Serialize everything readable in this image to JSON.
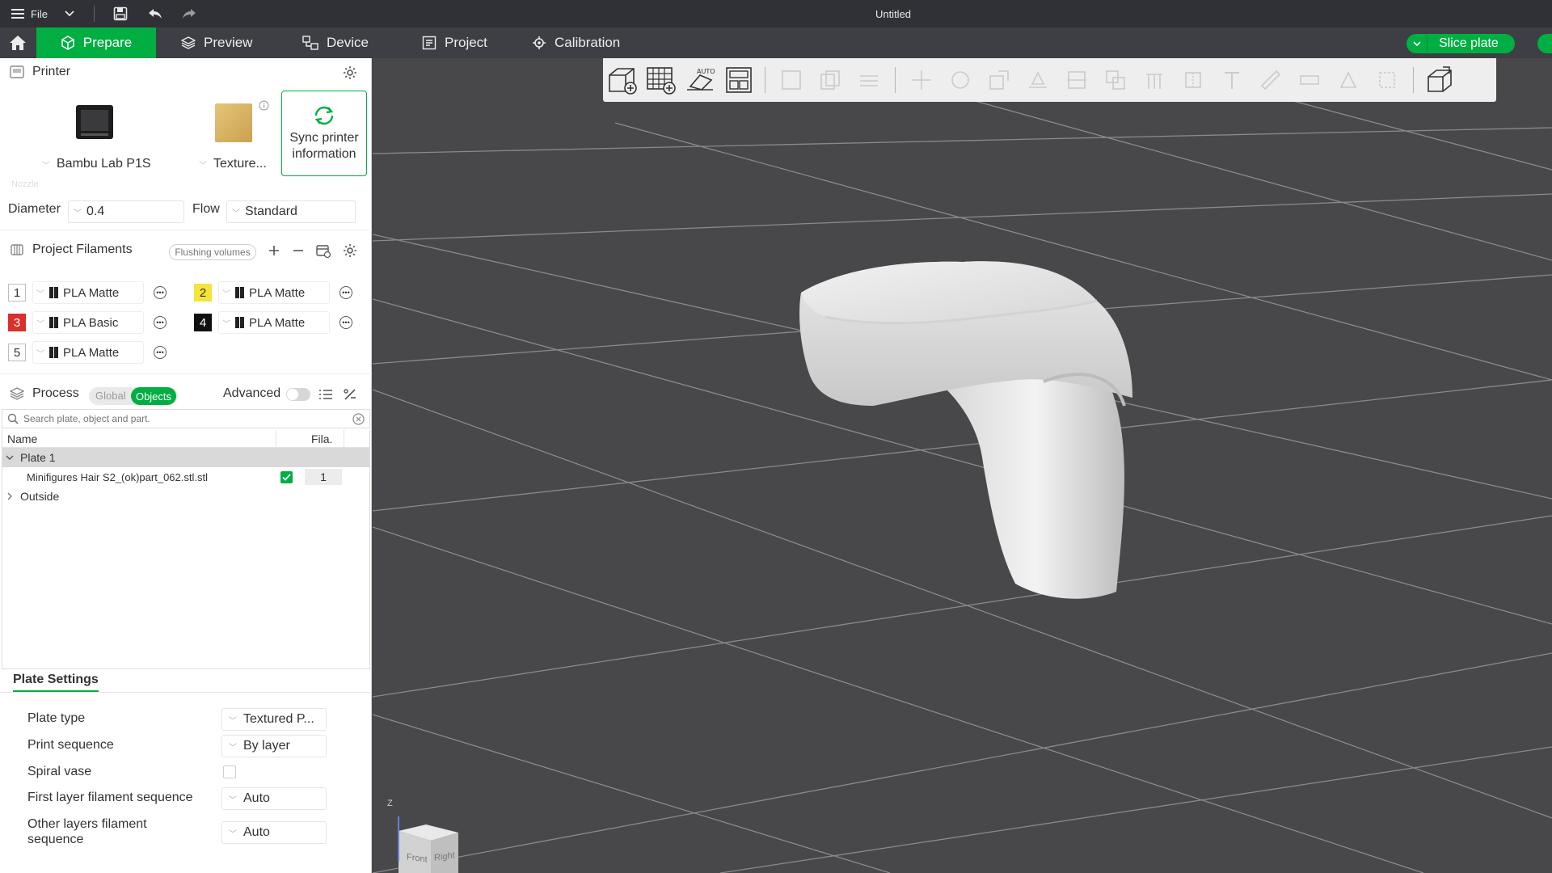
{
  "titlebar": {
    "file_label": "File",
    "window_title": "Untitled"
  },
  "nav": {
    "tabs": [
      {
        "label": "Prepare",
        "icon": "cube-icon",
        "active": true
      },
      {
        "label": "Preview",
        "icon": "layers-icon",
        "active": false
      },
      {
        "label": "Device",
        "icon": "device-icon",
        "active": false
      },
      {
        "label": "Project",
        "icon": "project-icon",
        "active": false
      },
      {
        "label": "Calibration",
        "icon": "calibration-icon",
        "active": false
      }
    ],
    "slice_label": "Slice plate",
    "accent_color": "#00ae42"
  },
  "printer": {
    "section_title": "Printer",
    "printer_name": "Bambu Lab P1S",
    "plate_name": "Texture...",
    "sync_label_1": "Sync printer",
    "sync_label_2": "information",
    "nozzle_caption": "Nozzle",
    "diameter_label": "Diameter",
    "diameter_value": "0.4",
    "flow_label": "Flow",
    "flow_value": "Standard"
  },
  "filaments": {
    "section_title": "Project Filaments",
    "flushing_label": "Flushing volumes",
    "items": [
      {
        "num": "1",
        "name": "PLA Matte",
        "color": "#ffffff",
        "text_color": "#333333"
      },
      {
        "num": "2",
        "name": "PLA Matte",
        "color": "#f5e43a",
        "text_color": "#333333"
      },
      {
        "num": "3",
        "name": "PLA Basic",
        "color": "#d9302b",
        "text_color": "#ffffff"
      },
      {
        "num": "4",
        "name": "PLA Matte",
        "color": "#111111",
        "text_color": "#ffffff"
      },
      {
        "num": "5",
        "name": "PLA Matte",
        "color": "#ffffff",
        "text_color": "#333333"
      }
    ]
  },
  "process": {
    "section_title": "Process",
    "global_label": "Global",
    "objects_label": "Objects",
    "advanced_label": "Advanced",
    "search_placeholder": "Search plate, object and part.",
    "col_name": "Name",
    "col_fila": "Fila.",
    "plate_label": "Plate 1",
    "object_label": "Minifigures Hair S2_(ok)part_062.stl.stl",
    "object_fila": "1",
    "outside_label": "Outside"
  },
  "plate_settings": {
    "tab_label": "Plate Settings",
    "rows": [
      {
        "label": "Plate type",
        "value": "Textured P..."
      },
      {
        "label": "Print sequence",
        "value": "By layer"
      },
      {
        "label": "Spiral vase",
        "value": ""
      },
      {
        "label": "First layer filament sequence",
        "value": "Auto"
      },
      {
        "label_1": "Other layers filament",
        "label_2": "sequence",
        "value": "Auto"
      }
    ]
  },
  "viewcube": {
    "axis": "Z",
    "front": "Front",
    "right": "Right"
  }
}
